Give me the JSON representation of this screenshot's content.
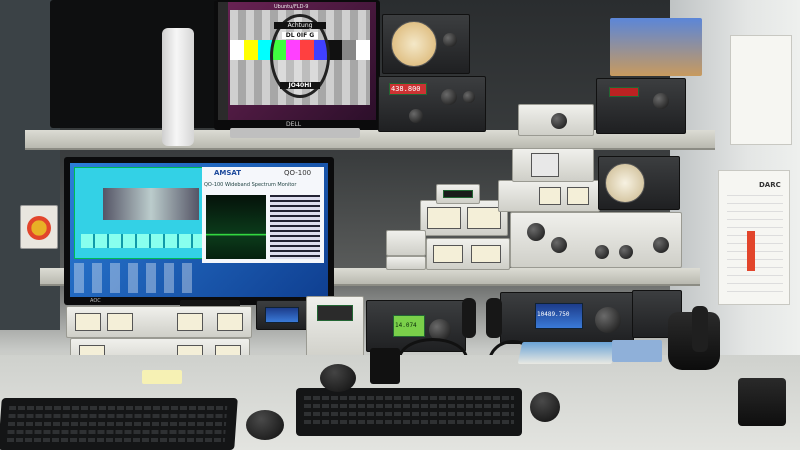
{
  "photo": {
    "description_kind": "amateur radio station workspace",
    "colors": {
      "wall": "#3a3d3e",
      "desk": "#e3e4e0",
      "ubuntu_purple": "#5b1e4f",
      "sdr_cyan": "#33d1e6",
      "desktop_blue": "#1e5ab8",
      "emergency_red": "#e2452b"
    }
  },
  "top_monitor": {
    "brand": "DELL",
    "window_title": "Ubuntu/FLD-9",
    "testcard": {
      "title": "Achtung",
      "line1": "DL 0IF G",
      "code": "JO40HI"
    }
  },
  "main_monitor": {
    "brand": "AOC",
    "sdr_app": {
      "logo_left": "AMSAT",
      "logo_right": "QO-100",
      "page_title": "QO-100 Wideband Spectrum Monitor"
    }
  },
  "radios": {
    "transceiver_center_display": "14.074",
    "transceiver_right_display": "10489.750",
    "upper_rack_display": "438.800"
  },
  "paper_right": {
    "heading": "DARC"
  },
  "icons": [
    "keyboard-icon",
    "mouse-icon",
    "telephone-icon",
    "microphone-icon",
    "emergency-stop-icon"
  ]
}
